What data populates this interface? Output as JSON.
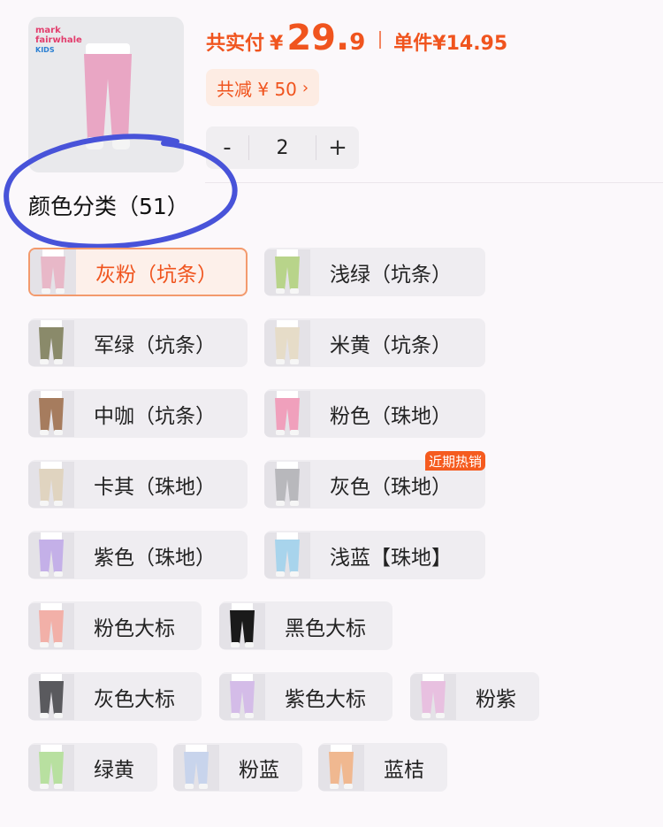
{
  "summary": {
    "total_label": "共实付",
    "currency": "¥",
    "total_int": "29.",
    "total_dec": "9",
    "unit_price": "单件¥14.95",
    "discount": "共减 ¥ 50",
    "discount_icon": "chevron-right-icon"
  },
  "product": {
    "brand_line1": "mark",
    "brand_line2": "fairwhale",
    "brand_line3": "KIDS"
  },
  "quantity": {
    "minus": "-",
    "value": "2",
    "plus": "+"
  },
  "colors": {
    "title": "颜色分类（51）",
    "accent": "#f0541e",
    "annotation_color": "#4853d9",
    "options": [
      {
        "label": "灰粉（坑条）",
        "selected": true,
        "swatch": "#e8b8c8"
      },
      {
        "label": "浅绿（坑条）",
        "swatch": "#b8d48a"
      },
      {
        "label": "军绿（坑条）",
        "swatch": "#8a8a6a"
      },
      {
        "label": "米黄（坑条）",
        "swatch": "#e6dcc8"
      },
      {
        "label": "中咖（坑条）",
        "swatch": "#a67c5e"
      },
      {
        "label": "粉色（珠地）",
        "swatch": "#f0a0bc"
      },
      {
        "label": "卡其（珠地）",
        "swatch": "#e0d4c0"
      },
      {
        "label": "灰色（珠地）",
        "swatch": "#b8b8bc",
        "badge": "近期热销"
      },
      {
        "label": "紫色（珠地）",
        "swatch": "#c4b0e8"
      },
      {
        "label": "浅蓝【珠地】",
        "swatch": "#a8d4ec"
      },
      {
        "label": "粉色大标",
        "swatch": "#f2b0a8"
      },
      {
        "label": "黑色大标",
        "swatch": "#1a1a1a"
      },
      {
        "label": "灰色大标",
        "swatch": "#5a5a5e"
      },
      {
        "label": "紫色大标",
        "swatch": "#d4bce8"
      },
      {
        "label": "粉紫",
        "swatch": "#e8c0e0"
      },
      {
        "label": "绿黄",
        "swatch": "#b8e0a0"
      },
      {
        "label": "粉蓝",
        "swatch": "#c8d4ec"
      },
      {
        "label": "蓝桔",
        "swatch": "#f0b890"
      }
    ]
  }
}
